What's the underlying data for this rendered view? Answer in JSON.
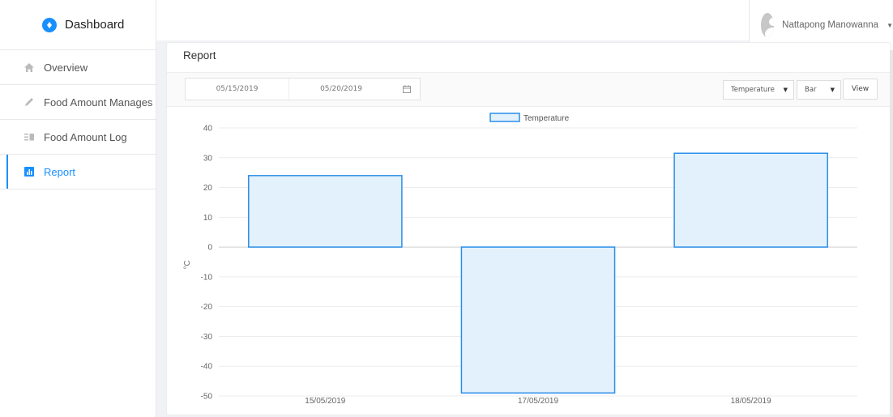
{
  "sidebar": {
    "brand": "Dashboard",
    "items": [
      {
        "label": "Overview",
        "icon": "home-icon"
      },
      {
        "label": "Food Amount Manages",
        "icon": "pencil-icon"
      },
      {
        "label": "Food Amount Log",
        "icon": "list-icon"
      },
      {
        "label": "Report",
        "icon": "bar-chart-icon",
        "active": true
      }
    ]
  },
  "header": {
    "user_name": "Nattapong Manowanna"
  },
  "report": {
    "title": "Report",
    "start_date": "05/15/2019",
    "end_date": "05/20/2019",
    "metric_select": "Temperature",
    "chart_type_select": "Bar",
    "view_label": "View"
  },
  "colors": {
    "accent": "#1890ff",
    "bar_fill": "#e3f1fd",
    "bar_stroke": "#2a8ee8"
  },
  "chart_data": {
    "type": "bar",
    "categories": [
      "15/05/2019",
      "17/05/2019",
      "18/05/2019"
    ],
    "series": [
      {
        "name": "Temperature",
        "values": [
          24,
          -49,
          31.5
        ]
      }
    ],
    "ylabel": "°C",
    "ylim": [
      -50,
      40
    ],
    "yticks": [
      40,
      30,
      20,
      10,
      0,
      -10,
      -20,
      -30,
      -40,
      -50
    ],
    "legend": "top-center",
    "grid": true
  }
}
